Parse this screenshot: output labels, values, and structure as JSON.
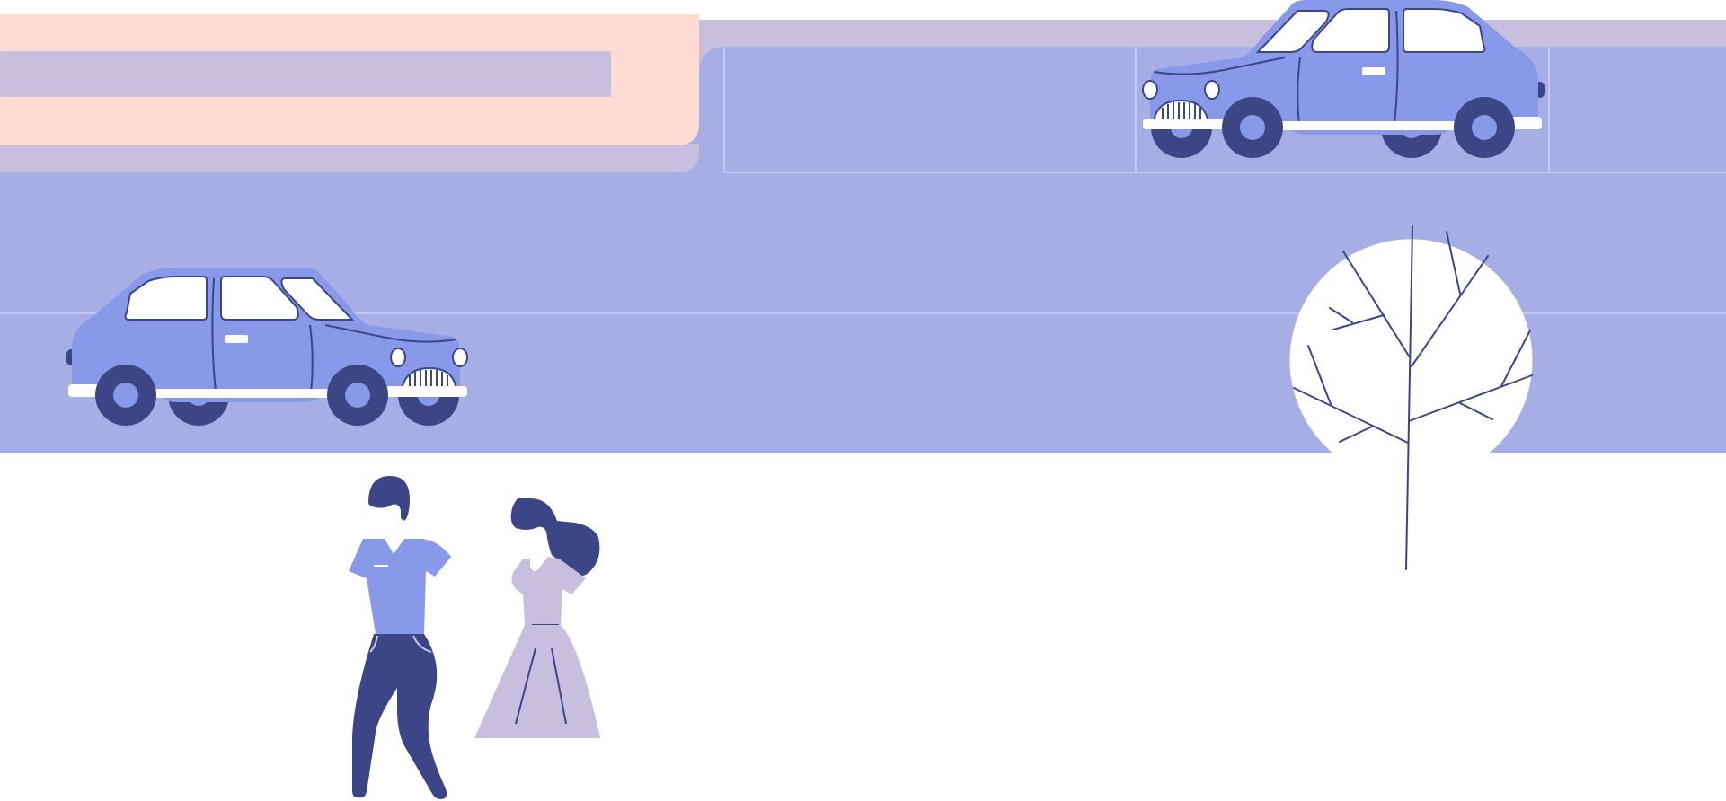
{
  "palette": {
    "background": "#ffffff",
    "road": "#a7ade5",
    "road_lines": "#c5c9ef",
    "peach": "#ffdcd3",
    "lavender": "#c8bfde",
    "car_body": "#8899ea",
    "navy": "#3c4687",
    "white": "#ffffff",
    "skin_shirt": "#8899ea",
    "dress": "#c8bfde"
  },
  "scene": {
    "elements": [
      "road",
      "overpass",
      "car-left",
      "car-right",
      "tree",
      "man",
      "woman"
    ]
  }
}
